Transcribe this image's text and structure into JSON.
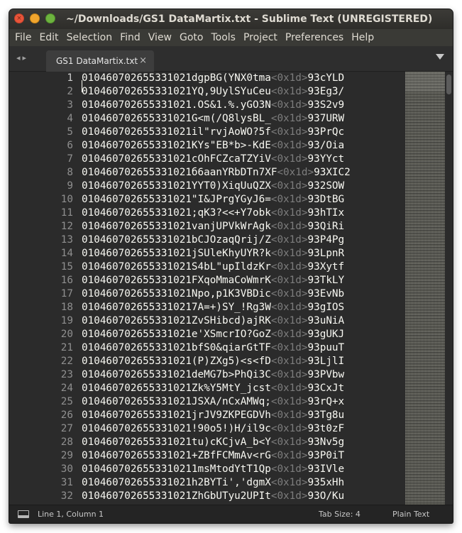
{
  "window": {
    "title": "~/Downloads/GS1 DataMartix.txt - Sublime Text (UNREGISTERED)"
  },
  "menu": [
    "File",
    "Edit",
    "Selection",
    "Find",
    "View",
    "Goto",
    "Tools",
    "Project",
    "Preferences",
    "Help"
  ],
  "tabs": [
    {
      "label": "GS1 DataMartix.txt",
      "close": "×",
      "active": true
    }
  ],
  "nav": {
    "back": "◂",
    "forward": "▸"
  },
  "editor": {
    "gs_marker": "<0x1d>",
    "lines": [
      {
        "num": "1",
        "pre": "010460702655331021dgpBG(YNX0tma",
        "post": "93cYLD"
      },
      {
        "num": "2",
        "pre": "010460702655331021YQ,9UylSYuCeu",
        "post": "93Eg3/"
      },
      {
        "num": "3",
        "pre": "010460702655331021.OS&1.%.yGO3N",
        "post": "93S2v9"
      },
      {
        "num": "4",
        "pre": "010460702655331021G<m(/Q8lysBL_",
        "post": "937URW"
      },
      {
        "num": "5",
        "pre": "010460702655331021il\"rvjAoWO?5f",
        "post": "93PrQc"
      },
      {
        "num": "6",
        "pre": "010460702655331021KYs\"EB*b>-KdE",
        "post": "93/Oia"
      },
      {
        "num": "7",
        "pre": "010460702655331021cOhFCZcaTZYiV",
        "post": "93YYct"
      },
      {
        "num": "8",
        "pre": "010460702655331021б6aanYRbDTn7XF",
        "post": "93XIC2"
      },
      {
        "num": "9",
        "pre": "010460702655331021YYT0)XiqUuQZX",
        "post": "932SOW"
      },
      {
        "num": "10",
        "pre": "010460702655331021\"I&JPrgYGyJ6=",
        "post": "93DtBG"
      },
      {
        "num": "11",
        "pre": "010460702655331021;qK3?<<+Y7obk",
        "post": "93hTIx"
      },
      {
        "num": "12",
        "pre": "010460702655331021vanjUPVkWrAgk",
        "post": "93QiRi"
      },
      {
        "num": "13",
        "pre": "010460702655331021bCJOzaqQrij/Z",
        "post": "93P4Pg"
      },
      {
        "num": "14",
        "pre": "010460702655331021jSUleKhyUYR?k",
        "post": "93LpnR"
      },
      {
        "num": "15",
        "pre": "010460702655331021S4bL\"upIldzKr",
        "post": "93Xytf"
      },
      {
        "num": "16",
        "pre": "010460702655331021FXqoMmaCoWmrK",
        "post": "93TkLY"
      },
      {
        "num": "17",
        "pre": "010460702655331021Npo,p1K3VBDic",
        "post": "93EvNb"
      },
      {
        "num": "18",
        "pre": "0104607026553310217A=+)SY_!Rg3W",
        "post": "93gIOS"
      },
      {
        "num": "19",
        "pre": "010460702655331021ZvSHibcd)ajRK",
        "post": "93uNiA"
      },
      {
        "num": "20",
        "pre": "010460702655331021e'XSmcrIO?GoZ",
        "post": "93gUKJ"
      },
      {
        "num": "21",
        "pre": "010460702655331021bfS0&qiarGtTF",
        "post": "93puuT"
      },
      {
        "num": "22",
        "pre": "010460702655331021(P)ZXg5)<s<fD",
        "post": "93LjlI"
      },
      {
        "num": "23",
        "pre": "010460702655331021deMG7b>PhQi3C",
        "post": "93PVbw"
      },
      {
        "num": "24",
        "pre": "010460702655331021Zk%Y5MtY_jcst",
        "post": "93CxJt"
      },
      {
        "num": "25",
        "pre": "010460702655331021JSXA/nCxAMWq;",
        "post": "93rQ+x"
      },
      {
        "num": "26",
        "pre": "010460702655331021jrJV9ZKPEGDVh",
        "post": "93Tg8u"
      },
      {
        "num": "27",
        "pre": "010460702655331021!90o5!)H/il9c",
        "post": "93t0zF"
      },
      {
        "num": "28",
        "pre": "010460702655331021tu)cKCjvA_b<Y",
        "post": "93Nv5g"
      },
      {
        "num": "29",
        "pre": "010460702655331021+ZBfFCMmAv<rG",
        "post": "93P0iT"
      },
      {
        "num": "30",
        "pre": "0104607026553310211msMtodYtT1Qp",
        "post": "93IVle"
      },
      {
        "num": "31",
        "pre": "010460702655331021h2BYTi','dgmX",
        "post": "935xHh"
      },
      {
        "num": "32",
        "pre": "010460702655331021ZhGbUTyu2UPIt",
        "post": "93O/Ku"
      }
    ]
  },
  "status": {
    "position": "Line 1, Column 1",
    "tab_size": "Tab Size: 4",
    "syntax": "Plain Text"
  },
  "colors": {
    "window_bg": "#2b2b2b",
    "text": "#f8f8f2",
    "gs_marker": "#7d7d7d",
    "gutter": "#8f8f8f"
  }
}
